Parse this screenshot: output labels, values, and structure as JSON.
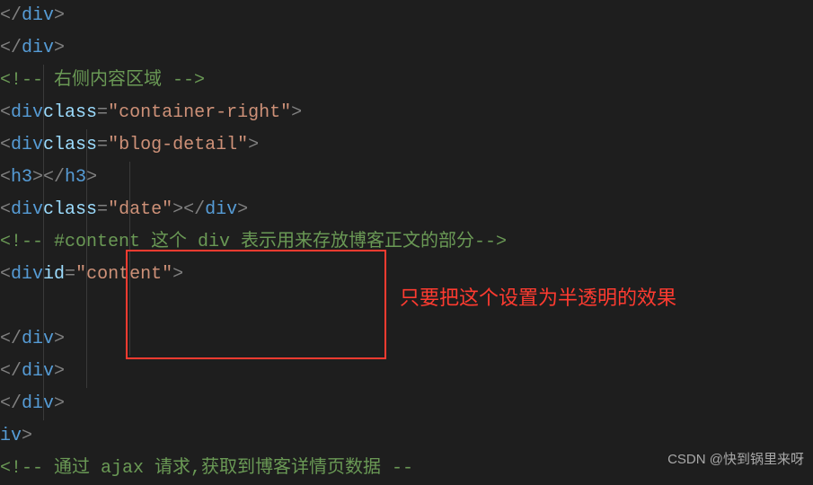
{
  "lines": {
    "l1_close_div": "div",
    "l2_close_div": "div",
    "l3_comment": "<!-- 右侧内容区域 -->",
    "l4_open": {
      "tag": "div",
      "attr": "class",
      "val": "\"container-right\""
    },
    "l5_open": {
      "tag": "div",
      "attr": "class",
      "val": "\"blog-detail\""
    },
    "l6_h3": "h3",
    "l7_open": {
      "tag": "div",
      "attr": "class",
      "val": "\"date\""
    },
    "l8_comment": "<!-- #content 这个 div 表示用来存放博客正文的部分-->",
    "l9_open": {
      "tag": "div",
      "attr": "id",
      "val": "\"content\""
    },
    "l10_blank": "",
    "l11_close_div": "div",
    "l12_close_div": "div",
    "l13_close_div": "div",
    "l14_iv": "iv",
    "l15_comment": "<!-- 通过 ajax 请求,获取到博客详情页数据 --"
  },
  "annotation": "只要把这个设置为半透明的效果",
  "watermark": "CSDN @快到锅里来呀"
}
